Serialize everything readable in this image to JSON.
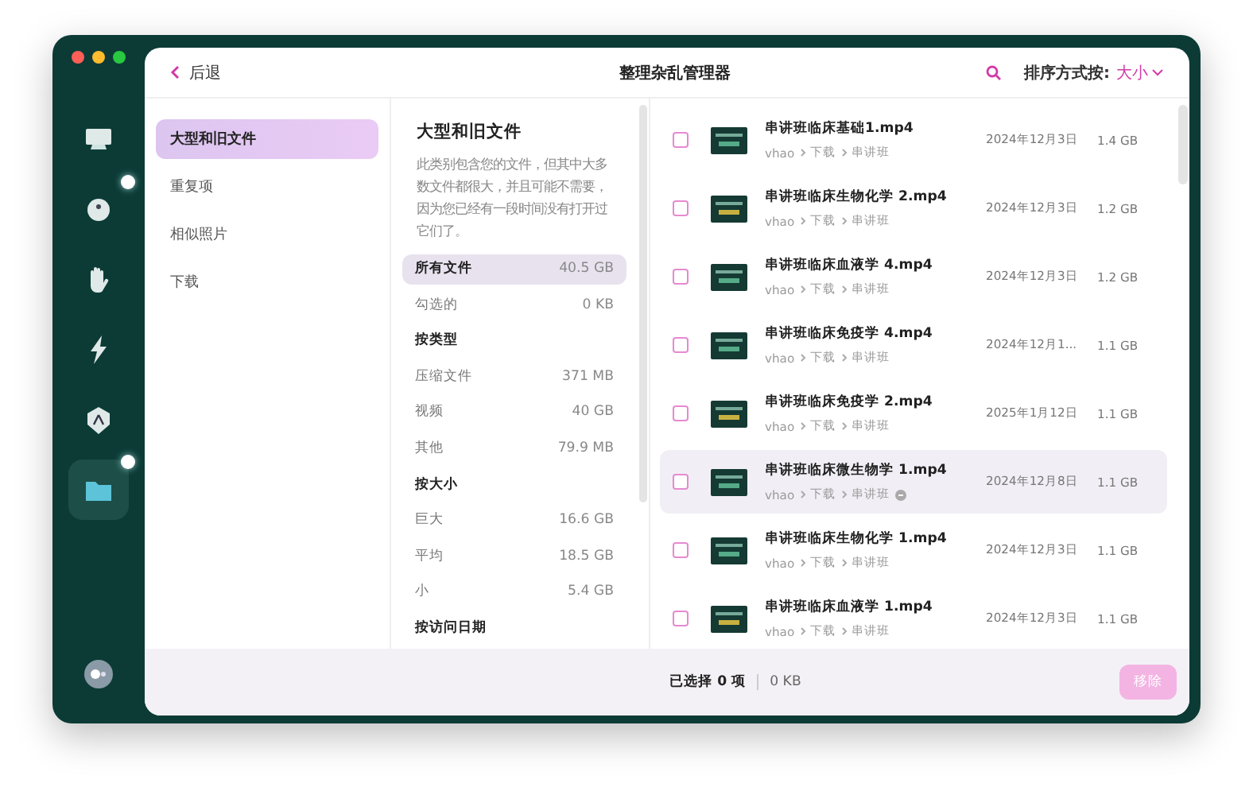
{
  "window": {
    "title": "整理杂乱管理器"
  },
  "back": {
    "label": "后退"
  },
  "sort": {
    "label": "排序方式按:",
    "value": "大小"
  },
  "sidebar": [
    {
      "kind": "monitor",
      "selected": false,
      "dot": false
    },
    {
      "kind": "disk",
      "selected": false,
      "dot": true
    },
    {
      "kind": "hand",
      "selected": false,
      "dot": false
    },
    {
      "kind": "lightning",
      "selected": false,
      "dot": false
    },
    {
      "kind": "shield",
      "selected": false,
      "dot": false
    },
    {
      "kind": "folder",
      "selected": true,
      "dot": true
    }
  ],
  "categories": [
    {
      "label": "大型和旧文件",
      "selected": true
    },
    {
      "label": "重复项",
      "selected": false
    },
    {
      "label": "相似照片",
      "selected": false
    },
    {
      "label": "下载",
      "selected": false
    }
  ],
  "info": {
    "title": "大型和旧文件",
    "description": "此类别包含您的文件，但其中大多数文件都很大，并且可能不需要，因为您已经有一段时间没有打开过它们了。"
  },
  "filters": [
    {
      "kind": "item",
      "label": "所有文件",
      "value": "40.5 GB",
      "selected": true
    },
    {
      "kind": "item",
      "label": "勾选的",
      "value": "0 KB",
      "selected": false
    },
    {
      "kind": "heading",
      "label": "按类型"
    },
    {
      "kind": "item",
      "label": "压缩文件",
      "value": "371 MB",
      "selected": false
    },
    {
      "kind": "item",
      "label": "视频",
      "value": "40 GB",
      "selected": false
    },
    {
      "kind": "item",
      "label": "其他",
      "value": "79.9 MB",
      "selected": false
    },
    {
      "kind": "heading",
      "label": "按大小"
    },
    {
      "kind": "item",
      "label": "巨大",
      "value": "16.6 GB",
      "selected": false
    },
    {
      "kind": "item",
      "label": "平均",
      "value": "18.5 GB",
      "selected": false
    },
    {
      "kind": "item",
      "label": "小",
      "value": "5.4 GB",
      "selected": false
    },
    {
      "kind": "heading",
      "label": "按访问日期"
    }
  ],
  "files": [
    {
      "name": "串讲班临床基础1.mp4",
      "path": [
        "vhao",
        "下载",
        "串讲班"
      ],
      "date": "2024年12月3日",
      "size": "1.4 GB",
      "checked": false,
      "selected": false,
      "cloud": false
    },
    {
      "name": "串讲班临床生物化学 2.mp4",
      "path": [
        "vhao",
        "下载",
        "串讲班"
      ],
      "date": "2024年12月3日",
      "size": "1.2 GB",
      "checked": false,
      "selected": false,
      "cloud": false
    },
    {
      "name": "串讲班临床血液学 4.mp4",
      "path": [
        "vhao",
        "下载",
        "串讲班"
      ],
      "date": "2024年12月3日",
      "size": "1.2 GB",
      "checked": false,
      "selected": false,
      "cloud": false
    },
    {
      "name": "串讲班临床免疫学 4.mp4",
      "path": [
        "vhao",
        "下载",
        "串讲班"
      ],
      "date": "2024年12月1...",
      "size": "1.1 GB",
      "checked": false,
      "selected": false,
      "cloud": false
    },
    {
      "name": "串讲班临床免疫学 2.mp4",
      "path": [
        "vhao",
        "下载",
        "串讲班"
      ],
      "date": "2025年1月12日",
      "size": "1.1 GB",
      "checked": false,
      "selected": false,
      "cloud": false
    },
    {
      "name": "串讲班临床微生物学 1.mp4",
      "path": [
        "vhao",
        "下载",
        "串讲班"
      ],
      "date": "2024年12月8日",
      "size": "1.1 GB",
      "checked": false,
      "selected": true,
      "cloud": true
    },
    {
      "name": "串讲班临床生物化学 1.mp4",
      "path": [
        "vhao",
        "下载",
        "串讲班"
      ],
      "date": "2024年12月3日",
      "size": "1.1 GB",
      "checked": false,
      "selected": false,
      "cloud": false
    },
    {
      "name": "串讲班临床血液学 1.mp4",
      "path": [
        "vhao",
        "下载",
        "串讲班"
      ],
      "date": "2024年12月3日",
      "size": "1.1 GB",
      "checked": false,
      "selected": false,
      "cloud": false
    }
  ],
  "footer": {
    "selected": "已选择 0 项",
    "size": "0 KB",
    "button": {
      "label": "移除",
      "disabled": true
    }
  }
}
